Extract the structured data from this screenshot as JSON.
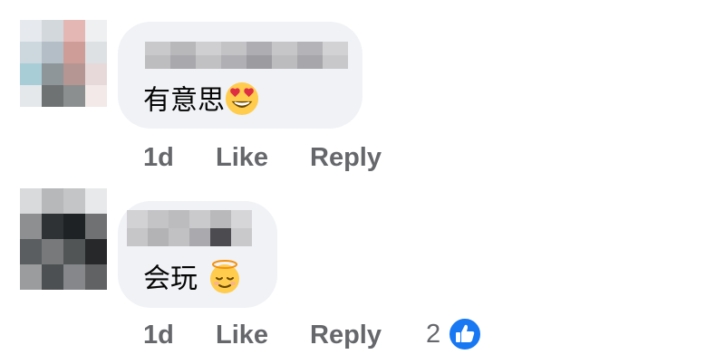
{
  "comments": [
    {
      "text": "有意思",
      "emoji": "heart-eyes-emoji",
      "timestamp": "1d",
      "like_label": "Like",
      "reply_label": "Reply",
      "reaction_count": ""
    },
    {
      "text": "会玩",
      "emoji": "smiling-face-with-halo-emoji",
      "timestamp": "1d",
      "like_label": "Like",
      "reply_label": "Reply",
      "reaction_count": "2",
      "reaction_icon": "like-thumbs-up-icon"
    }
  ],
  "colors": {
    "bubble": "#f0f2f5",
    "meta_text": "#65676b",
    "like_blue": "#1877f2"
  }
}
